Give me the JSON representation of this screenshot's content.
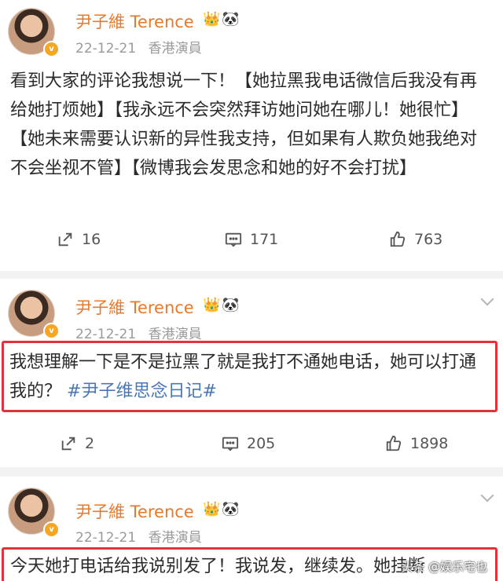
{
  "posts": [
    {
      "author": "尹子維 Terence",
      "date": "22-12-21",
      "verification": "香港演員",
      "text": "看到大家的评论我想说一下！【她拉黑我电话微信后我没有再给她打烦她】【我永远不会突然拜访她问她在哪儿！她很忙】【她未来需要认识新的异性我支持，但如果有人欺负她我绝对不会坐视不管】【微博我会发思念和她的好不会打扰】",
      "reposts": "16",
      "comments": "171",
      "likes": "763"
    },
    {
      "author": "尹子維 Terence",
      "date": "22-12-21",
      "verification": "香港演員",
      "text": "我想理解一下是不是拉黑了就是我打不通她电话，她可以打通我的？",
      "hashtag": "#尹子维思念日记#",
      "reposts": "2",
      "comments": "205",
      "likes": "1898"
    },
    {
      "author": "尹子維 Terence",
      "date": "22-12-21",
      "verification": "香港演員",
      "text": "今天她打电话给我说别发了！我说发，继续发。她挂断"
    }
  ],
  "watermark": "头条 @娱乐宅也",
  "icons": {
    "crown": "crown-icon",
    "panda": "panda-icon",
    "verified": "verified-badge-icon",
    "repost": "repost-icon",
    "comment": "comment-icon",
    "like": "thumbs-up-icon",
    "more": "chevron-down-icon"
  },
  "colors": {
    "author_name": "#e7792a",
    "highlight_border": "#e0333b",
    "hashtag": "#4a77b5",
    "meta": "#9a9a9a"
  }
}
